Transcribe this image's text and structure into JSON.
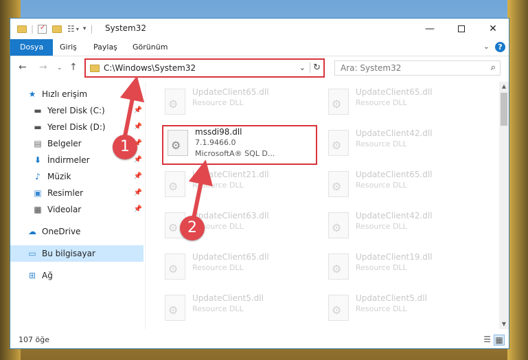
{
  "window": {
    "title": "System32"
  },
  "ribbon": {
    "tabs": [
      "Dosya",
      "Giriş",
      "Paylaş",
      "Görünüm"
    ]
  },
  "address": {
    "path": "C:\\Windows\\System32"
  },
  "search": {
    "placeholder": "Ara: System32"
  },
  "sidebar": {
    "quick_access": "Hızlı erişim",
    "items": [
      {
        "label": "Yerel Disk (C:)",
        "icon": "drive-icon"
      },
      {
        "label": "Yerel Disk (D:)",
        "icon": "drive-icon"
      },
      {
        "label": "Belgeler",
        "icon": "document-icon"
      },
      {
        "label": "İndirmeler",
        "icon": "download-icon"
      },
      {
        "label": "Müzik",
        "icon": "music-icon"
      },
      {
        "label": "Resimler",
        "icon": "picture-icon"
      },
      {
        "label": "Videolar",
        "icon": "video-icon"
      }
    ],
    "onedrive": "OneDrive",
    "this_pc": "Bu bilgisayar",
    "network": "Ağ"
  },
  "files": {
    "left": [
      {
        "name": "UpdateClient65.dll",
        "desc": "Resource DLL"
      },
      {
        "name": "mssdi98.dll",
        "version": "7.1.9466.0",
        "desc": "MicrosoftA® SQL D...",
        "highlight": true
      },
      {
        "name": "UpdateClient21.dll",
        "desc": "Resource DLL"
      },
      {
        "name": "UpdateClient63.dll",
        "desc": "Resource DLL"
      },
      {
        "name": "UpdateClient65.dll",
        "desc": "Resource DLL"
      },
      {
        "name": "UpdateClient5.dll",
        "desc": "Resource DLL"
      }
    ],
    "right": [
      {
        "name": "UpdateClient65.dll",
        "desc": "Resource DLL"
      },
      {
        "name": "UpdateClient42.dll",
        "desc": "Resource DLL"
      },
      {
        "name": "UpdateClient65.dll",
        "desc": "Resource DLL"
      },
      {
        "name": "UpdateClient42.dll",
        "desc": "Resource DLL"
      },
      {
        "name": "UpdateClient19.dll",
        "desc": "Resource DLL"
      },
      {
        "name": "UpdateClient5.dll",
        "desc": "Resource DLL"
      }
    ]
  },
  "status": {
    "count": "107 öğe"
  },
  "callouts": [
    "1",
    "2"
  ],
  "colors": {
    "accent": "#1979ca",
    "highlight_red": "#d9323a",
    "callout": "#e0484d"
  }
}
